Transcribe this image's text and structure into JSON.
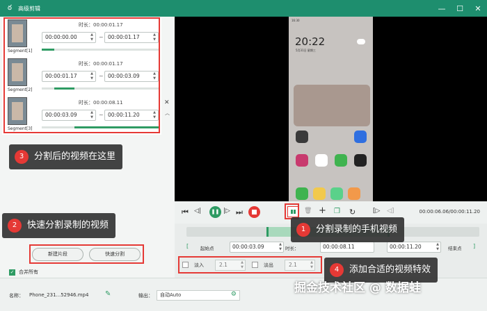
{
  "window": {
    "title": "高级剪辑",
    "logo_glyph": "ఠ",
    "minimize": "—",
    "maximize": "☐",
    "close": "✕"
  },
  "segments": [
    {
      "label": "Segment[1]",
      "duration": "时长：00:00:01.17",
      "start": "00:00:00.00",
      "end": "00:00:01.17",
      "fill_start": 0.0,
      "fill_end": 0.11
    },
    {
      "label": "Segment[2]",
      "duration": "时长：00:00:01.17",
      "start": "00:00:01.17",
      "end": "00:00:03.09",
      "fill_start": 0.11,
      "fill_end": 0.28
    },
    {
      "label": "Segment[3]",
      "duration": "时长：00:00:08.11",
      "start": "00:00:03.09",
      "end": "00:00:11.20",
      "fill_start": 0.28,
      "fill_end": 1.0
    }
  ],
  "segment_tilde": "~",
  "segment_close": "✕",
  "segment_scroll": "︿",
  "buttons": {
    "new_segment": "新建片段",
    "quick_split": "快速分割"
  },
  "merge": {
    "checked_glyph": "✓",
    "label": "合并所有"
  },
  "phone": {
    "statusbar": "16:30",
    "clock": "20:22",
    "date": "5月31日 星期三"
  },
  "player": {
    "skip_start": "⏮",
    "step_back": "◁|",
    "play": "❚❚",
    "step_fwd": "|▷",
    "skip_end": "⏭",
    "delete": "🗑",
    "add": "+",
    "copy": "❐",
    "reset": "↻",
    "mark_in": "[▷",
    "mark_out": "◁]",
    "timecode": "00:00:06.06/00:00:11.20"
  },
  "times": {
    "open_bracket": "[",
    "start_label": "起始点",
    "start_value": "00:00:03.09",
    "duration_label": "时长：",
    "duration_value": "00:00:08.11",
    "end_value": "00:00:11.20",
    "end_label": "结束点",
    "close_bracket": "]"
  },
  "fade": {
    "in_label": "淡入",
    "in_value": "2.1",
    "out_label": "淡出",
    "out_value": "2.1"
  },
  "spinner": "▲\n▼",
  "bottom": {
    "name_label": "名称：",
    "file_name": "Phone_231...52946.mp4",
    "edit_glyph": "✎",
    "output_label": "输出：",
    "output_value": "自动Auto",
    "gear_glyph": "⚙"
  },
  "callouts": [
    {
      "num": "1",
      "text": "分割录制的手机视频"
    },
    {
      "num": "2",
      "text": "快速分割录制的视频"
    },
    {
      "num": "3",
      "text": "分割后的视频在这里"
    },
    {
      "num": "4",
      "text": "添加合适的视频特效"
    }
  ],
  "watermark": "掘金技术社区 @ 数据蛙",
  "colors": {
    "accent": "#2e9b63",
    "titlebar": "#1e8e6e",
    "highlight": "#e53935"
  }
}
